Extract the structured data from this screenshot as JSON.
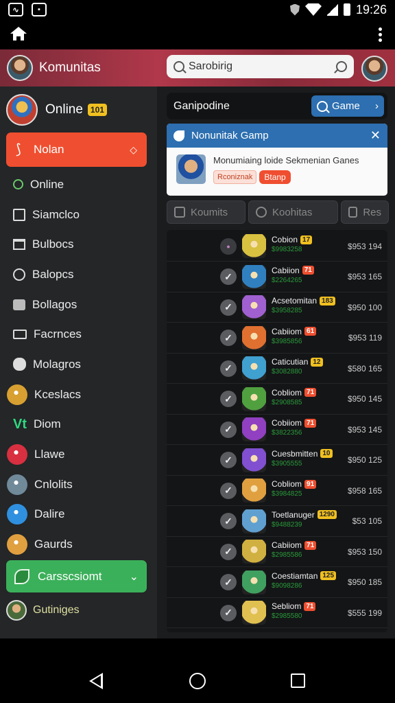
{
  "status_bar": {
    "time": "19:26"
  },
  "header": {
    "title": "Komunitas",
    "search_value": "Sarobirig"
  },
  "sidebar": {
    "profile": {
      "label": "Online",
      "badge": "101"
    },
    "active_item": {
      "label": "Nolan"
    },
    "items": [
      {
        "label": "Online",
        "icon": "search-icon"
      },
      {
        "label": "Siamclco",
        "icon": "square-icon"
      },
      {
        "label": "Bulbocs",
        "icon": "grid-icon"
      },
      {
        "label": "Balopcs",
        "icon": "pin-icon"
      },
      {
        "label": "Bollagos",
        "icon": "bag-icon"
      },
      {
        "label": "Facrnces",
        "icon": "card-icon"
      },
      {
        "label": "Molagros",
        "icon": "blob-icon"
      },
      {
        "label": "Kceslacs",
        "icon": "game-icon",
        "color": "#d8a030"
      },
      {
        "label": "Diom",
        "icon": "vh-icon",
        "color": "#2fd880"
      },
      {
        "label": "Llawe",
        "icon": "game-icon",
        "color": "#d83040"
      },
      {
        "label": "Cnlolits",
        "icon": "game-icon",
        "color": "#708a9a"
      },
      {
        "label": "Dalire",
        "icon": "game-icon",
        "color": "#3090e0"
      },
      {
        "label": "Gaurds",
        "icon": "game-icon",
        "color": "#e0a040"
      }
    ],
    "green_item": {
      "label": "Carsscsiomt"
    },
    "bottom_item": {
      "label": "Gutiniges"
    }
  },
  "main": {
    "section_title": "Ganipodine",
    "game_button": "Game",
    "notification": {
      "title": "Nonunitak Gamp",
      "body": "Monumiaing loide Sekmenian Ganes",
      "tag1": "Rconiznak",
      "tag2": "Btanp"
    },
    "tabs": [
      {
        "label": "Koumits"
      },
      {
        "label": "Koohitas"
      },
      {
        "label": "Res"
      }
    ],
    "rows": [
      {
        "name": "Cobion",
        "badge": "17",
        "badge_color": "#f0c020",
        "code": "$9983258",
        "price": "$953 194",
        "thumb": "#d8c040",
        "check": false
      },
      {
        "name": "Cabiion",
        "badge": "71",
        "badge_color": "#ef4f30",
        "code": "$2264265",
        "price": "$953 165",
        "thumb": "#3080c0",
        "check": true
      },
      {
        "name": "Acsetomitan",
        "badge": "183",
        "badge_color": "#f0c020",
        "code": "$3958285",
        "price": "$950 100",
        "thumb": "#a060d0",
        "check": true
      },
      {
        "name": "Cabiiom",
        "badge": "61",
        "badge_color": "#ef4f30",
        "code": "$3985856",
        "price": "$953 119",
        "thumb": "#e07030",
        "check": true
      },
      {
        "name": "Caticutian",
        "badge": "12",
        "badge_color": "#f0c020",
        "code": "$3082880",
        "price": "$580 165",
        "thumb": "#40a0d0",
        "check": true
      },
      {
        "name": "Cobliom",
        "badge": "71",
        "badge_color": "#ef4f30",
        "code": "$2908585",
        "price": "$950 145",
        "thumb": "#50a040",
        "check": true
      },
      {
        "name": "Cobiiom",
        "badge": "71",
        "badge_color": "#ef4f30",
        "code": "$3822356",
        "price": "$953 145",
        "thumb": "#9040c0",
        "check": true
      },
      {
        "name": "Cuesbmitten",
        "badge": "10",
        "badge_color": "#f0c020",
        "code": "$3905555",
        "price": "$950 125",
        "thumb": "#8050d0",
        "check": true
      },
      {
        "name": "Cobliom",
        "badge": "91",
        "badge_color": "#ef4f30",
        "code": "$3984825",
        "price": "$958 165",
        "thumb": "#e0a040",
        "check": true
      },
      {
        "name": "Toetlanuger",
        "badge": "1290",
        "badge_color": "#f0c020",
        "code": "$9488239",
        "price": "$53 105",
        "thumb": "#60a0d0",
        "check": true
      },
      {
        "name": "Cabiiom",
        "badge": "71",
        "badge_color": "#ef4f30",
        "code": "$2985586",
        "price": "$953 150",
        "thumb": "#d0b040",
        "check": true
      },
      {
        "name": "Coestiamtan",
        "badge": "125",
        "badge_color": "#f0c020",
        "code": "$9098286",
        "price": "$950 185",
        "thumb": "#40a060",
        "check": true
      },
      {
        "name": "Sebliom",
        "badge": "71",
        "badge_color": "#ef4f30",
        "code": "$2985580",
        "price": "$555 199",
        "thumb": "#e0c050",
        "check": true
      }
    ]
  }
}
